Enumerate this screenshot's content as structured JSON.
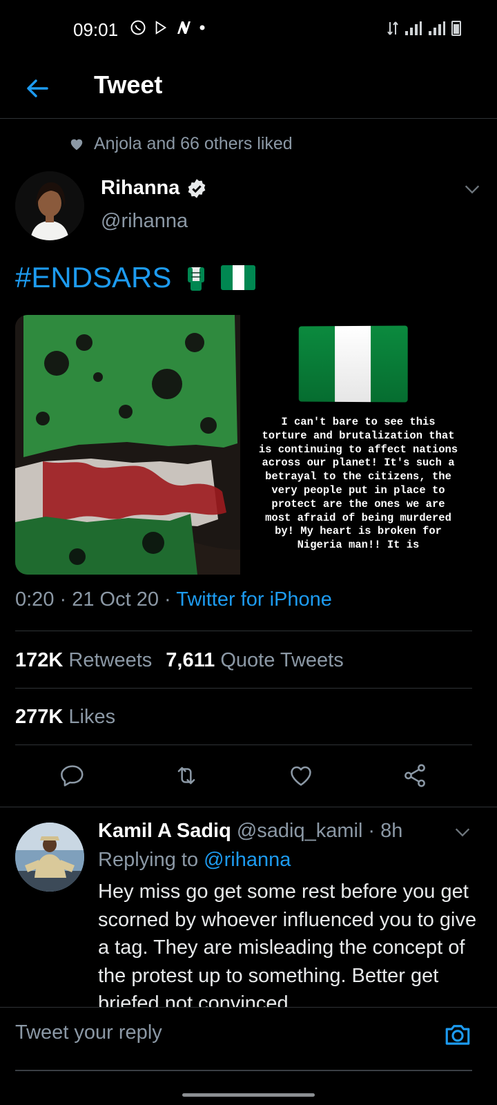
{
  "status_bar": {
    "time": "09:01"
  },
  "header": {
    "title": "Tweet"
  },
  "social_context": {
    "text": "Anjola and 66 others liked"
  },
  "author": {
    "name": "Rihanna",
    "handle": "@rihanna"
  },
  "tweet": {
    "hashtag": "#ENDSARS",
    "story_text": "I can't bare to see this torture and brutalization that is continuing to affect nations across our planet! It's such a betrayal to the citizens, the very people put in place to protect are the ones we are most afraid of being murdered by! My heart is broken for Nigeria man!! It is",
    "time": "0:20",
    "date": "21 Oct 20",
    "source": "Twitter for iPhone"
  },
  "stats": {
    "retweets_count": "172K",
    "retweets_label": "Retweets",
    "quotes_count": "7,611",
    "quotes_label": "Quote Tweets",
    "likes_count": "277K",
    "likes_label": "Likes"
  },
  "reply": {
    "name": "Kamil A Sadiq",
    "handle": "@sadiq_kamil",
    "age": "8h",
    "replying_label": "Replying to",
    "replying_to": "@rihanna",
    "text": "Hey miss go get some rest before you get scorned by whoever influenced you to give a tag. They are misleading the concept of the protest up to something. Better get briefed not convinced"
  },
  "composer": {
    "placeholder": "Tweet your reply"
  },
  "colors": {
    "accent": "#1d9bf0",
    "background": "#000000",
    "muted": "#8b98a5",
    "nigeria_green": "#008751"
  }
}
